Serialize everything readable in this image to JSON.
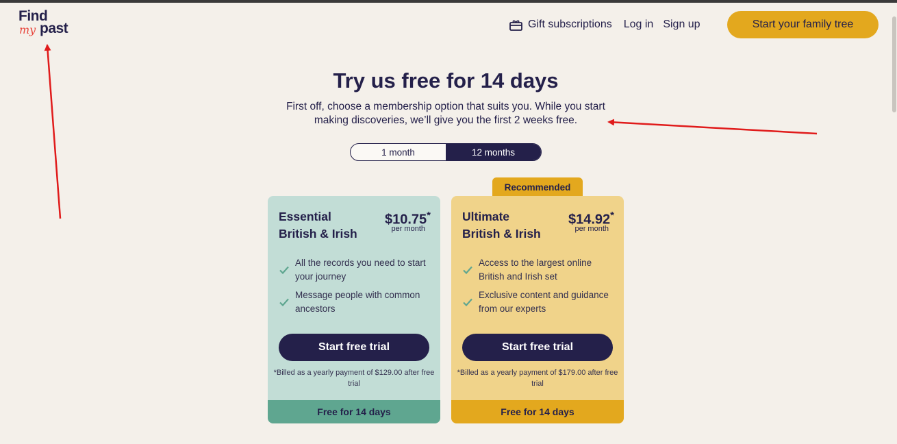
{
  "header": {
    "logo": {
      "line1": "Find",
      "line2_script": "my",
      "line3": "past"
    },
    "nav": {
      "gift_label": "Gift subscriptions",
      "login_label": "Log in",
      "signup_label": "Sign up",
      "cta_label": "Start your family tree"
    }
  },
  "hero": {
    "title": "Try us free for 14 days",
    "subtitle": "First off, choose a membership option that suits you. While you start making discoveries, we’ll give you the first 2 weeks free."
  },
  "toggle": {
    "options": [
      "1 month",
      "12 months"
    ],
    "selected": "12 months"
  },
  "badge_label": "Recommended",
  "plans": [
    {
      "name_line1": "Essential",
      "name_line2": "British & Irish",
      "price": "$10.75",
      "asterisk": "*",
      "per": "per month",
      "features": [
        "All the records you need to start your journey",
        "Message people with common ancestors"
      ],
      "button_label": "Start free trial",
      "billing": "*Billed as a yearly payment of $129.00 after free trial",
      "footer": "Free for 14 days"
    },
    {
      "name_line1": "Ultimate",
      "name_line2": "British & Irish",
      "price": "$14.92",
      "asterisk": "*",
      "per": "per month",
      "features": [
        "Access to the largest online British and Irish set",
        "Exclusive content and guidance from our experts"
      ],
      "button_label": "Start free trial",
      "billing": "*Billed as a yearly payment of $179.00 after free trial",
      "footer": "Free for 14 days"
    }
  ],
  "colors": {
    "background": "#f4f0ea",
    "navy": "#24204a",
    "gold": "#e3a81e",
    "essential_card": "#c2ddd6",
    "essential_footer": "#5fa690",
    "ultimate_card": "#f0d38a",
    "check": "#5fa690",
    "annotation_arrow": "#e01b1b"
  }
}
